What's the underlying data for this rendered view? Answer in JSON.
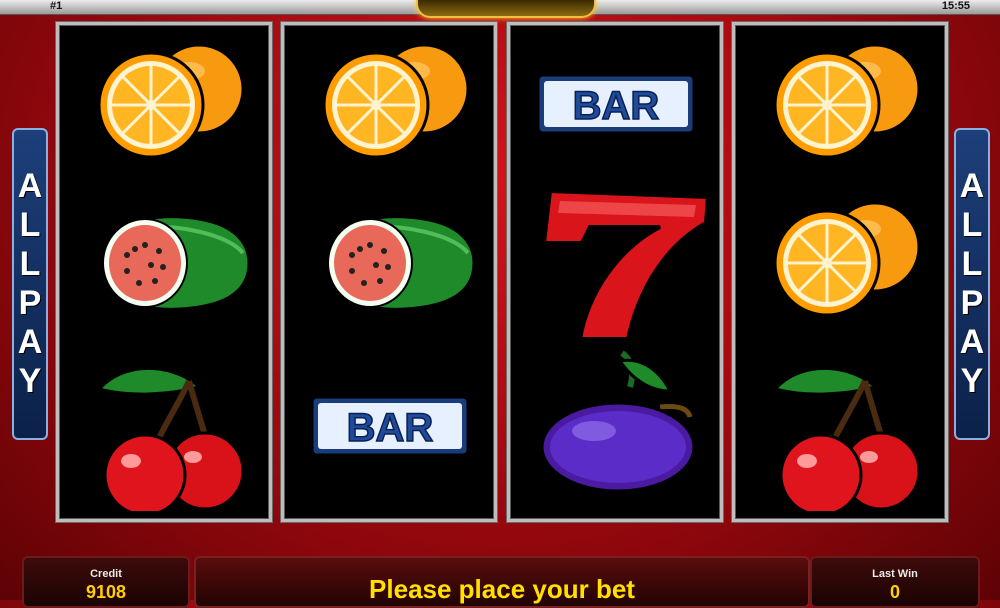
{
  "top_bar": {
    "game_number": "#1",
    "clock": "15:55"
  },
  "side_labels": {
    "left": [
      "A",
      "L",
      "L",
      "P",
      "A",
      "Y"
    ],
    "right": [
      "A",
      "L",
      "L",
      "P",
      "A",
      "Y"
    ]
  },
  "reels": [
    [
      "orange",
      "watermelon",
      "cherries"
    ],
    [
      "orange",
      "watermelon",
      "bar"
    ],
    [
      "bar",
      "seven",
      "plum"
    ],
    [
      "orange",
      "orange",
      "cherries"
    ]
  ],
  "bar_label": "BAR",
  "bottom": {
    "credit_label": "Credit",
    "credit_value": "9108",
    "message": "Please place your bet",
    "last_win_label": "Last Win",
    "last_win_value": "0"
  }
}
